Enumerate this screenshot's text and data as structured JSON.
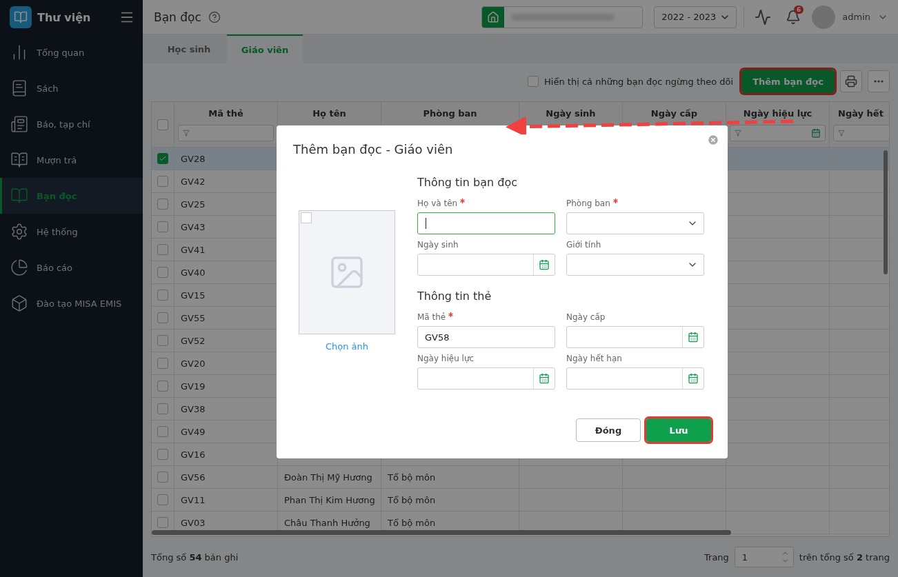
{
  "app": {
    "name": "Thư viện"
  },
  "sidebar": {
    "items": [
      {
        "label": "Tổng quan",
        "selected": false
      },
      {
        "label": "Sách",
        "selected": false
      },
      {
        "label": "Báo, tạp chí",
        "selected": false
      },
      {
        "label": "Mượn trả",
        "selected": false
      },
      {
        "label": "Bạn đọc",
        "selected": true
      },
      {
        "label": "Hệ thống",
        "selected": false
      },
      {
        "label": "Báo cáo",
        "selected": false
      },
      {
        "label": "Đào tạo MISA EMIS",
        "selected": false
      }
    ]
  },
  "topbar": {
    "title": "Bạn đọc",
    "year": "2022 - 2023",
    "notifications": "6",
    "user": "admin"
  },
  "tabs": [
    {
      "label": "Học sinh",
      "selected": false
    },
    {
      "label": "Giáo viên",
      "selected": true
    }
  ],
  "toolbar": {
    "show_inactive": {
      "label": "Hiển thị cả những bạn đọc ngừng theo dõi",
      "checked": false
    },
    "add_button": {
      "label": "Thêm bạn đọc",
      "highlighted": true
    }
  },
  "table": {
    "select_all": {
      "checked": false
    },
    "columns": [
      {
        "label": "Mã thẻ",
        "kind": "text"
      },
      {
        "label": "Họ tên"
      },
      {
        "label": "Phòng ban"
      },
      {
        "label": "Ngày sinh"
      },
      {
        "label": "Ngày cấp"
      },
      {
        "label": "Ngày hiệu lực",
        "kind": "date"
      },
      {
        "label": "Ngày hết",
        "kind": "text"
      }
    ],
    "rows": [
      {
        "selected": true,
        "cells": [
          "GV28"
        ]
      },
      {
        "selected": false,
        "cells": [
          "GV42"
        ]
      },
      {
        "selected": false,
        "cells": [
          "GV25"
        ]
      },
      {
        "selected": false,
        "cells": [
          "GV43"
        ]
      },
      {
        "selected": false,
        "cells": [
          "GV41"
        ]
      },
      {
        "selected": false,
        "cells": [
          "GV40"
        ]
      },
      {
        "selected": false,
        "cells": [
          "GV15"
        ]
      },
      {
        "selected": false,
        "cells": [
          "GV55"
        ]
      },
      {
        "selected": false,
        "cells": [
          "GV52"
        ]
      },
      {
        "selected": false,
        "cells": [
          "GV20"
        ]
      },
      {
        "selected": false,
        "cells": [
          "GV19"
        ]
      },
      {
        "selected": false,
        "cells": [
          "GV38"
        ]
      },
      {
        "selected": false,
        "cells": [
          "GV49"
        ]
      },
      {
        "selected": false,
        "cells": [
          "GV16"
        ]
      },
      {
        "selected": false,
        "cells": [
          "GV56",
          "Đoàn Thị Mỹ Hương",
          "Tổ bộ môn"
        ]
      },
      {
        "selected": false,
        "cells": [
          "GV11",
          "Phan Thị Kim Hương",
          "Tổ bộ môn"
        ]
      },
      {
        "selected": false,
        "cells": [
          "GV03",
          "Châu Thanh Hưởng",
          "Tổ bộ môn"
        ]
      }
    ]
  },
  "footer": {
    "total": "Tổng số **54** bản ghi",
    "page_label": "Trang",
    "page": "1",
    "pages": "trên tổng số **2** trang"
  },
  "dialog": {
    "title": "Thêm bạn đọc - Giáo viên",
    "photo_link": "Chọn ảnh",
    "photo_checked": false,
    "sections": [
      {
        "title": "Thông tin bạn đọc",
        "fields": [
          {
            "label": "Họ và tên",
            "kind": "text",
            "required": true,
            "focused": true
          },
          {
            "label": "Phòng ban",
            "kind": "select",
            "required": true,
            "focused": false
          },
          {
            "label": "Ngày sinh",
            "kind": "date",
            "required": false,
            "focused": false
          },
          {
            "label": "Giới tính",
            "kind": "select",
            "required": false,
            "focused": false
          }
        ]
      },
      {
        "title": "Thông tin thẻ",
        "fields": [
          {
            "label": "Mã thẻ",
            "kind": "text",
            "required": true,
            "focused": false,
            "value": "GV58"
          },
          {
            "label": "Ngày cấp",
            "kind": "date",
            "required": false,
            "focused": false
          },
          {
            "label": "Ngày hiệu lực",
            "kind": "date",
            "required": false,
            "focused": false
          },
          {
            "label": "Ngày hết hạn",
            "kind": "date",
            "required": false,
            "focused": false
          }
        ]
      }
    ],
    "buttons": [
      {
        "label": "Đóng",
        "kind": "secondary",
        "highlighted": false
      },
      {
        "label": "Lưu",
        "kind": "primary",
        "highlighted": true
      }
    ]
  }
}
